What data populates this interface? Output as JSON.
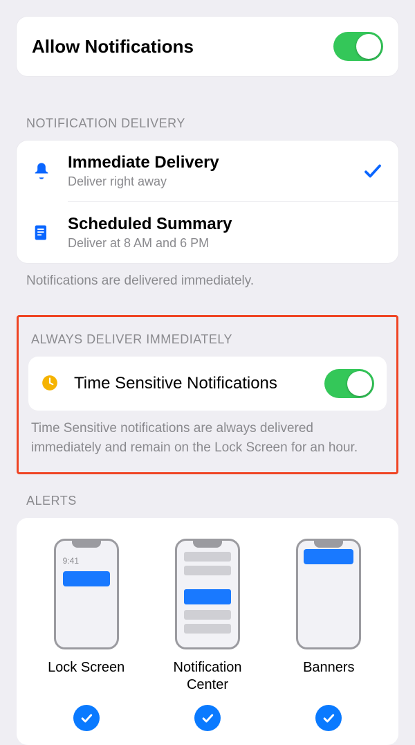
{
  "allow": {
    "label": "Allow Notifications",
    "on": true
  },
  "delivery": {
    "header": "NOTIFICATION DELIVERY",
    "immediate": {
      "title": "Immediate Delivery",
      "sub": "Deliver right away",
      "selected": true
    },
    "scheduled": {
      "title": "Scheduled Summary",
      "sub": "Deliver at 8 AM and 6 PM",
      "selected": false
    },
    "footer": "Notifications are delivered immediately."
  },
  "always": {
    "header": "ALWAYS DELIVER IMMEDIATELY",
    "time_sensitive": {
      "label": "Time Sensitive Notifications",
      "on": true
    },
    "footer": "Time Sensitive notifications are always delivered immediately and remain on the Lock Screen for an hour."
  },
  "alerts": {
    "header": "ALERTS",
    "lock": {
      "label": "Lock Screen",
      "time": "9:41",
      "checked": true
    },
    "center": {
      "label": "Notification Center",
      "checked": true
    },
    "banners": {
      "label": "Banners",
      "checked": true
    }
  }
}
